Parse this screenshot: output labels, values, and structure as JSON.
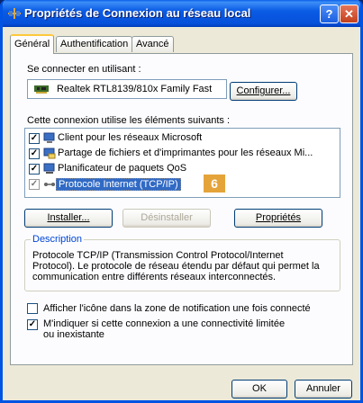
{
  "window": {
    "title": "Propriétés de Connexion au réseau local",
    "help_label": "?",
    "close_label": "✕"
  },
  "tabs": [
    {
      "label": "Général",
      "active": true
    },
    {
      "label": "Authentification",
      "active": false
    },
    {
      "label": "Avancé",
      "active": false
    }
  ],
  "connect_using": {
    "label": "Se connecter en utilisant :",
    "adapter": "Realtek RTL8139/810x Family Fast",
    "configure_label": "Configurer..."
  },
  "components": {
    "label": "Cette connexion utilise les éléments suivants :",
    "items": [
      {
        "label": "Client pour les réseaux Microsoft",
        "checked": true,
        "icon": "network-client-icon"
      },
      {
        "label": "Partage de fichiers et d'imprimantes pour les réseaux Mi...",
        "checked": true,
        "icon": "file-share-icon"
      },
      {
        "label": "Planificateur de paquets QoS",
        "checked": true,
        "icon": "qos-scheduler-icon"
      },
      {
        "label": "Protocole Internet (TCP/IP)",
        "checked": true,
        "icon": "protocol-icon",
        "selected": true
      }
    ],
    "badge": "6"
  },
  "component_buttons": {
    "install": "Installer...",
    "uninstall": "Désinstaller",
    "properties": "Propriétés"
  },
  "description": {
    "legend": "Description",
    "text": "Protocole TCP/IP (Transmission Control Protocol/Internet Protocol). Le protocole de réseau étendu par défaut qui permet la communication entre différents réseaux interconnectés."
  },
  "options": {
    "show_icon": "Afficher l'icône dans la zone de notification une fois connecté",
    "notify_limited": "M'indiquer si cette connexion a une connectivité limitée ou inexistante"
  },
  "dialog_buttons": {
    "ok": "OK",
    "cancel": "Annuler"
  },
  "colors": {
    "titlebar": "#0a5fe8",
    "selection": "#316ac5",
    "badge": "#e5a43a"
  }
}
